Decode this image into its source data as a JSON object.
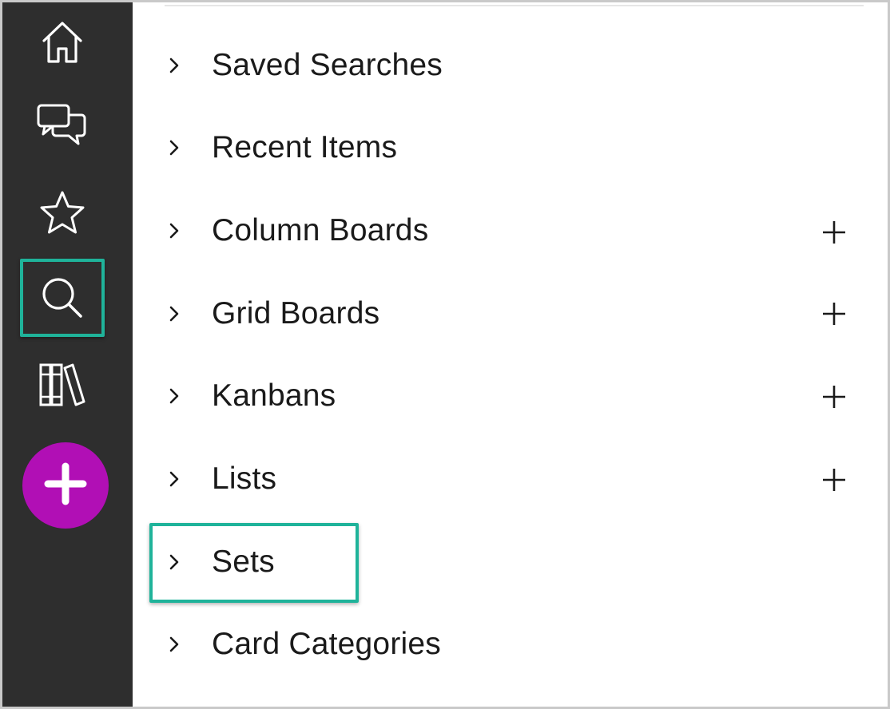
{
  "colors": {
    "rail_background": "#2e2e2e",
    "rail_icon": "#ffffff",
    "highlight": "#1fb39a",
    "add_button": "#b10fb5",
    "text": "#1a1a1a"
  },
  "rail": {
    "items": [
      {
        "icon": "home-icon",
        "selected": false
      },
      {
        "icon": "chat-bubbles-icon",
        "selected": false
      },
      {
        "icon": "star-icon",
        "selected": false
      },
      {
        "icon": "search-icon",
        "selected": true
      },
      {
        "icon": "library-icon",
        "selected": false
      }
    ],
    "add_button": {
      "icon": "plus-icon"
    }
  },
  "panel": {
    "rows": [
      {
        "label": "Saved Searches",
        "has_add": false
      },
      {
        "label": "Recent Items",
        "has_add": false
      },
      {
        "label": "Column Boards",
        "has_add": true
      },
      {
        "label": "Grid Boards",
        "has_add": true
      },
      {
        "label": "Kanbans",
        "has_add": true
      },
      {
        "label": "Lists",
        "has_add": true
      },
      {
        "label": "Sets",
        "has_add": false,
        "highlighted": true
      },
      {
        "label": "Card Categories",
        "has_add": false
      }
    ]
  }
}
